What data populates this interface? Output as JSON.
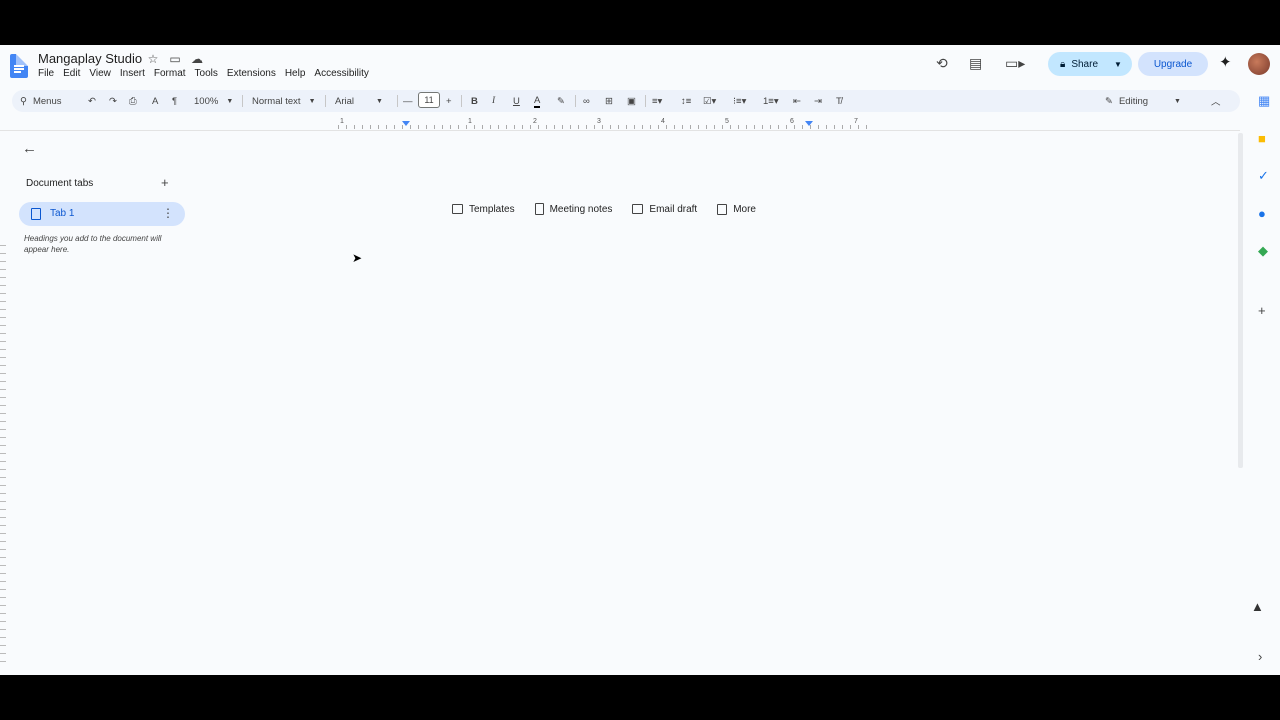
{
  "doc": {
    "title": "Mangaplay Studio"
  },
  "menu": [
    "File",
    "Edit",
    "View",
    "Insert",
    "Format",
    "Tools",
    "Extensions",
    "Help",
    "Accessibility"
  ],
  "header": {
    "share_label": "Share",
    "upgrade_label": "Upgrade"
  },
  "toolbar": {
    "menus_label": "Menus",
    "zoom": "100%",
    "style": "Normal text",
    "font": "Arial",
    "font_size": "11",
    "mode": "Editing"
  },
  "ruler": {
    "labels": [
      "1",
      "1",
      "2",
      "3",
      "4",
      "5",
      "6",
      "7"
    ]
  },
  "tabs": {
    "heading": "Document tabs",
    "items": [
      {
        "label": "Tab 1"
      }
    ],
    "hint": "Headings you add to the document will appear here."
  },
  "chips": [
    {
      "label": "Templates",
      "icon": "templates-icon"
    },
    {
      "label": "Meeting notes",
      "icon": "meeting-notes-icon"
    },
    {
      "label": "Email draft",
      "icon": "email-draft-icon"
    },
    {
      "label": "More",
      "icon": "more-icon"
    }
  ],
  "colors": {
    "accent": "#0b57d0",
    "share_bg": "#c2e7ff",
    "tab_bg": "#d3e3fd",
    "canvas": "#f9fbfd"
  }
}
